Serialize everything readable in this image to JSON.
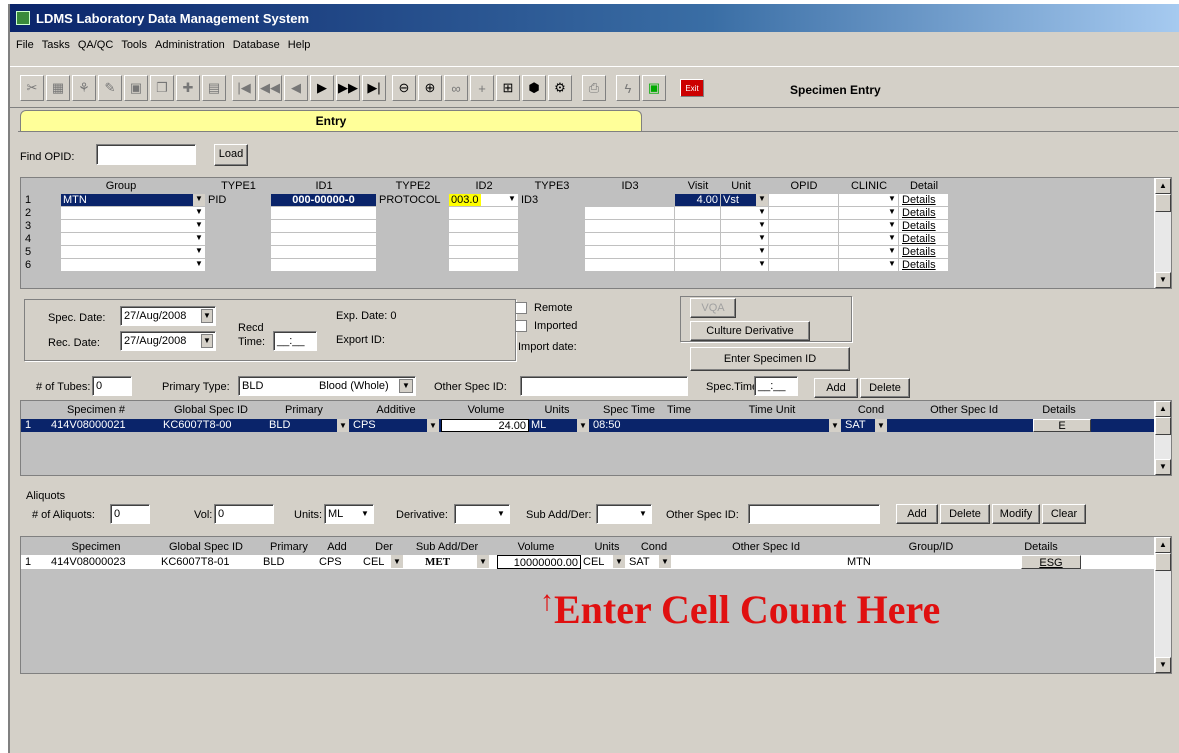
{
  "window": {
    "title": "LDMS Laboratory Data Management System"
  },
  "menu": [
    "File",
    "Tasks",
    "QA/QC",
    "Tools",
    "Administration",
    "Database",
    "Help"
  ],
  "toolbar": {
    "title": "Specimen Entry",
    "exit_label": "Exit",
    "icons": [
      "cut-icon",
      "grid-icon",
      "tree-icon",
      "edit-icon",
      "calc-icon",
      "copy-icon",
      "paste-icon",
      "doc-icon",
      "first-icon",
      "prev-page-icon",
      "prev-icon",
      "next-icon",
      "next-page-icon",
      "last-icon",
      "zoom-out-icon",
      "zoom-in-icon",
      "binoculars-icon",
      "add-icon",
      "network-icon",
      "box-icon",
      "tools-icon",
      "print-icon",
      "lightning-icon",
      "monitor-icon",
      "exit-icon"
    ]
  },
  "tab": {
    "label": "Entry"
  },
  "find": {
    "label": "Find OPID:",
    "value": "",
    "load": "Load"
  },
  "id_grid": {
    "headers": [
      "Group",
      "TYPE1",
      "ID1",
      "TYPE2",
      "ID2",
      "TYPE3",
      "ID3",
      "Visit",
      "Unit",
      "OPID",
      "CLINIC",
      "Detail"
    ],
    "row1": {
      "n": "1",
      "group": "MTN",
      "type1": "PID",
      "id1": "000-00000-0",
      "type2": "PROTOCOL",
      "id2": "003.0",
      "type3": "ID3",
      "visit": "4.00",
      "unit": "Vst",
      "detail": "Details"
    },
    "rows": [
      "2",
      "3",
      "4",
      "5",
      "6"
    ],
    "detail_label": "Details"
  },
  "spec": {
    "spec_date_label": "Spec. Date:",
    "spec_date": "27/Aug/2008",
    "rec_date_label": "Rec. Date:",
    "rec_date": "27/Aug/2008",
    "recd_label": "Recd",
    "time_label": "Time:",
    "time_value": "__:__",
    "exp_date": "Exp. Date: 0",
    "export_id": "Export ID:",
    "remote": "Remote",
    "imported": "Imported",
    "import_date": "Import date:",
    "vqa": "VQA",
    "culture": "Culture Derivative",
    "enter_specimen": "Enter Specimen ID"
  },
  "tubes": {
    "tubes_label": "# of Tubes:",
    "tubes_value": "0",
    "primary_label": "Primary Type:",
    "primary_code": "BLD",
    "primary_name": "Blood (Whole)",
    "other_label": "Other Spec ID:",
    "spec_time_label": "Spec.Time:",
    "spec_time_value": "__:__",
    "add": "Add",
    "delete": "Delete"
  },
  "specimen_grid": {
    "headers": [
      "Specimen #",
      "Global Spec ID",
      "Primary",
      "Additive",
      "Volume",
      "Units",
      "Spec Time",
      "Time",
      "Time Unit",
      "Cond",
      "Other Spec Id",
      "Details"
    ],
    "row": {
      "n": "1",
      "spec": "414V08000021",
      "global": "KC6007T8-00",
      "primary": "BLD",
      "additive": "CPS",
      "volume": "24.00",
      "units": "ML",
      "spec_time": "08:50",
      "cond": "SAT",
      "details": "E"
    }
  },
  "aliquots": {
    "title": "Aliquots",
    "count_label": "# of Aliquots:",
    "count_value": "0",
    "vol_label": "Vol:",
    "vol_value": "0",
    "units_label": "Units:",
    "units_value": "ML",
    "derivative_label": "Derivative:",
    "subadd_label": "Sub Add/Der:",
    "other_label": "Other Spec ID:",
    "add": "Add",
    "delete": "Delete",
    "modify": "Modify",
    "clear": "Clear"
  },
  "aliquot_grid": {
    "headers": [
      "Specimen",
      "Global Spec ID",
      "Primary",
      "Add",
      "Der",
      "Sub Add/Der",
      "Volume",
      "Units",
      "Cond",
      "Other Spec Id",
      "Group/ID",
      "Details"
    ],
    "row": {
      "n": "1",
      "spec": "414V08000023",
      "global": "KC6007T8-01",
      "primary": "BLD",
      "add": "CPS",
      "der": "CEL",
      "subadd": "MET",
      "volume": "10000000.00",
      "units": "CEL",
      "cond": "SAT",
      "group": "MTN",
      "details": "ESG"
    }
  },
  "annotation": {
    "text": "Enter Cell Count Here",
    "arrow": "↑",
    "color": "#e01010"
  }
}
